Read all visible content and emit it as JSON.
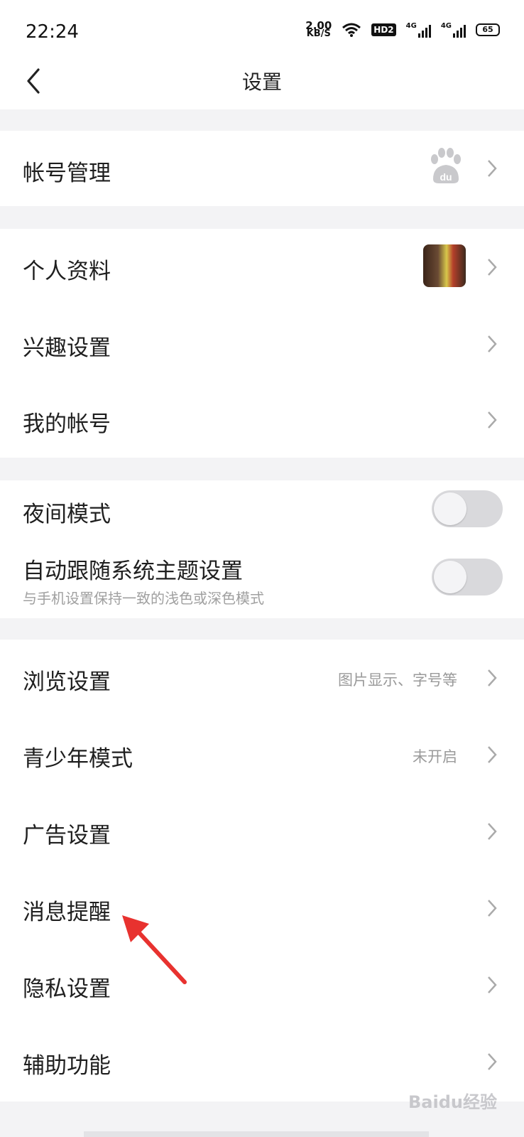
{
  "status": {
    "time": "22:24",
    "speed_value": "2.00",
    "speed_unit": "KB/S",
    "hd": "HD2",
    "net1": "4G",
    "net2": "4G",
    "battery": "65"
  },
  "header": {
    "title": "设置"
  },
  "sections": {
    "account": {
      "label": "帐号管理"
    },
    "profile": [
      {
        "label": "个人资料"
      },
      {
        "label": "兴趣设置"
      },
      {
        "label": "我的帐号"
      }
    ],
    "theme": {
      "night": {
        "label": "夜间模式",
        "on": false
      },
      "auto": {
        "label": "自动跟随系统主题设置",
        "subtitle": "与手机设置保持一致的浅色或深色模式",
        "on": false
      }
    },
    "misc": [
      {
        "label": "浏览设置",
        "value": "图片显示、字号等"
      },
      {
        "label": "青少年模式",
        "value": "未开启"
      },
      {
        "label": "广告设置"
      },
      {
        "label": "消息提醒"
      },
      {
        "label": "隐私设置"
      },
      {
        "label": "辅助功能"
      }
    ]
  },
  "watermark": "Baidu经验"
}
